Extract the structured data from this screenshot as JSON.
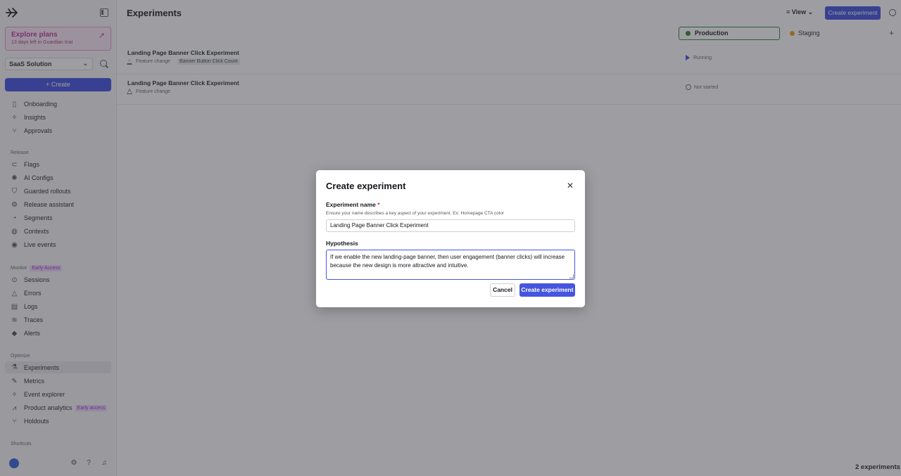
{
  "sidebar": {
    "logo_icon": "arrow-logo-icon",
    "explore": {
      "title": "Explore plans",
      "subtitle": "13 days left in Guardian trial"
    },
    "project": "SaaS Solution",
    "create_label": "+ Create",
    "top_items": [
      {
        "label": "Onboarding",
        "icon": "map-icon"
      },
      {
        "label": "Insights",
        "icon": "sparkle-icon"
      },
      {
        "label": "Approvals",
        "icon": "branch-icon"
      }
    ],
    "release_label": "Release",
    "release_items": [
      {
        "label": "Flags",
        "icon": "toggle-icon"
      },
      {
        "label": "AI Configs",
        "icon": "ai-icon"
      },
      {
        "label": "Guarded rollouts",
        "icon": "shield-icon"
      },
      {
        "label": "Release assistant",
        "icon": "assistant-icon"
      },
      {
        "label": "Segments",
        "icon": "segments-icon"
      },
      {
        "label": "Contexts",
        "icon": "contexts-icon"
      },
      {
        "label": "Live events",
        "icon": "live-icon"
      }
    ],
    "monitor_label": "Monitor",
    "monitor_badge": "Early Access",
    "monitor_items": [
      {
        "label": "Sessions",
        "icon": "play-circle-icon"
      },
      {
        "label": "Errors",
        "icon": "warning-icon"
      },
      {
        "label": "Logs",
        "icon": "logs-icon"
      },
      {
        "label": "Traces",
        "icon": "traces-icon"
      },
      {
        "label": "Alerts",
        "icon": "alert-icon"
      }
    ],
    "optimize_label": "Optimize",
    "optimize_items": [
      {
        "label": "Experiments",
        "icon": "flask-icon"
      },
      {
        "label": "Metrics",
        "icon": "ruler-icon"
      },
      {
        "label": "Event explorer",
        "icon": "explorer-icon"
      },
      {
        "label": "Product analytics",
        "icon": "analytics-icon",
        "badge": "Early access"
      },
      {
        "label": "Holdouts",
        "icon": "holdouts-icon"
      }
    ],
    "shortcuts_label": "Shortcuts"
  },
  "header": {
    "title": "Experiments",
    "view_label": "View",
    "create_label": "Create experiment"
  },
  "environments": {
    "production": "Production",
    "staging": "Staging"
  },
  "experiments": [
    {
      "name": "Landing Page Banner Click Experiment",
      "type": "Feature change",
      "metric": "Banner Button Click Count",
      "status": "Running"
    },
    {
      "name": "Landing Page Banner Click Experiment",
      "type": "Feature change",
      "metric": "",
      "status": "Not started"
    }
  ],
  "count_label": "2 experiments",
  "modal": {
    "title": "Create experiment",
    "name_label": "Experiment name",
    "required_mark": "*",
    "name_help": "Ensure your name describes a key aspect of your experiment. Ex: Homepage CTA color",
    "name_value": "Landing Page Banner Click Experiment",
    "hypothesis_label": "Hypothesis",
    "hypothesis_value": "If we enable the new landing-page banner, then user engagement (banner clicks) will increase because the new design is more attractive and intuitive.",
    "cancel_label": "Cancel",
    "submit_label": "Create experiment"
  },
  "colors": {
    "accent": "#4555e0",
    "production": "#2f8b3b",
    "staging": "#e8a01f"
  }
}
